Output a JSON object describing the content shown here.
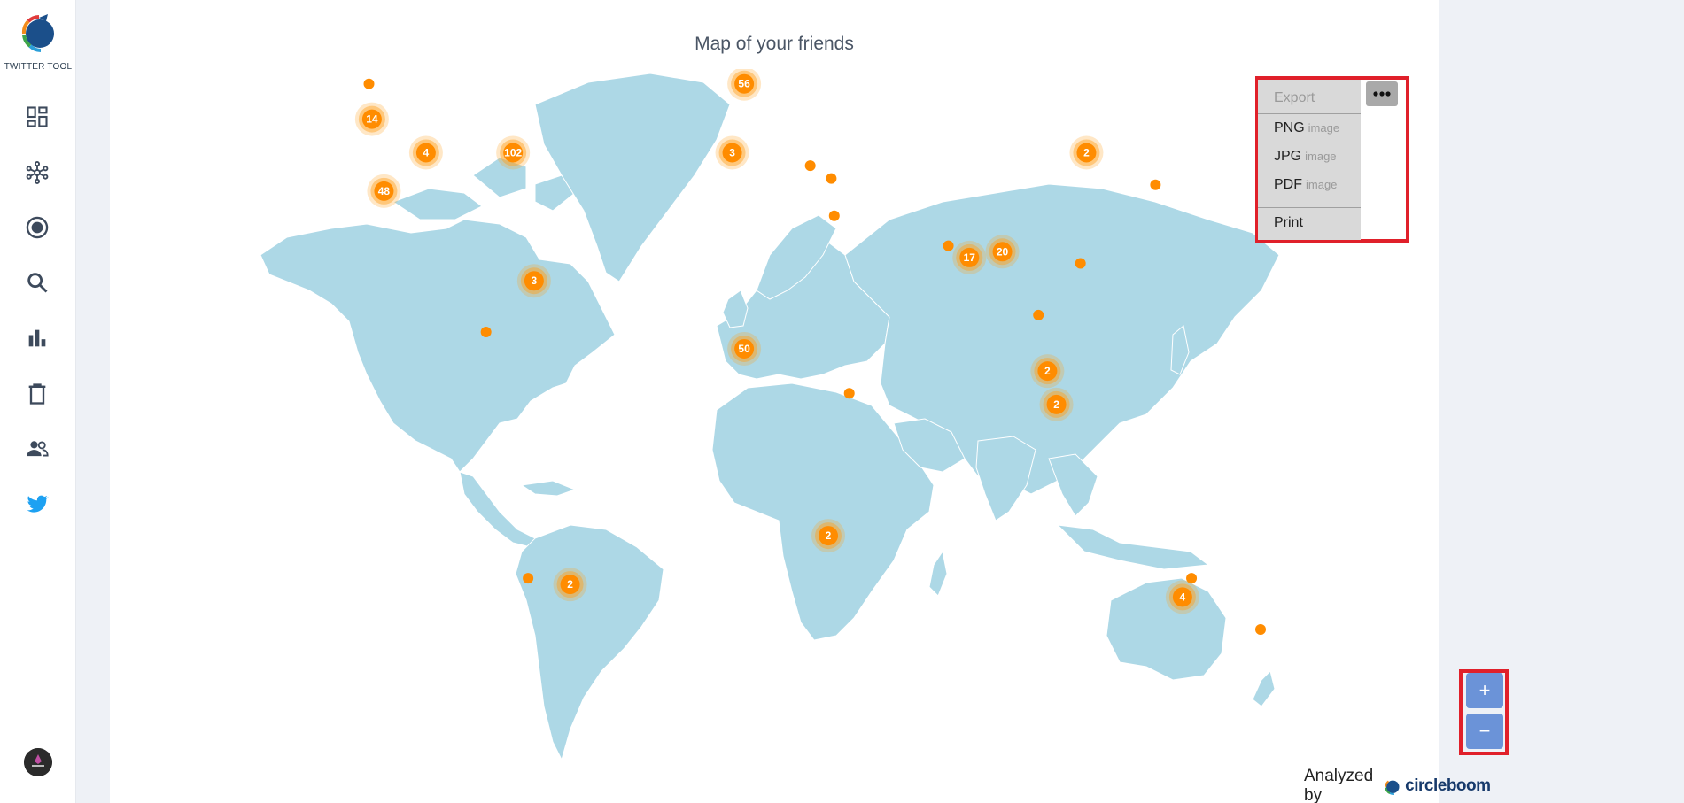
{
  "sidebar": {
    "logo_text": "TWITTER TOOL",
    "items": [
      {
        "icon": "dashboard-icon"
      },
      {
        "icon": "network-icon"
      },
      {
        "icon": "target-icon"
      },
      {
        "icon": "search-icon"
      },
      {
        "icon": "bar-chart-icon"
      },
      {
        "icon": "trash-icon"
      },
      {
        "icon": "users-icon"
      },
      {
        "icon": "twitter-bird-icon"
      }
    ]
  },
  "page": {
    "title": "Map of your friends"
  },
  "export_menu": {
    "header": "Export",
    "items": [
      {
        "label": "PNG",
        "sub": "image"
      },
      {
        "label": "JPG",
        "sub": "image"
      },
      {
        "label": "PDF",
        "sub": "image"
      }
    ],
    "print_label": "Print",
    "button_icon": "more-horizontal-icon"
  },
  "zoom": {
    "in_label": "+",
    "out_label": "−"
  },
  "footer": {
    "analyzed_by": "Analyzed by",
    "brand": "circleboom"
  },
  "map": {
    "clusters": [
      {
        "label": "14",
        "lon": -122,
        "lat": 45
      },
      {
        "label": "4",
        "lon": -104,
        "lat": 40
      },
      {
        "label": "48",
        "lon": -118,
        "lat": 34
      },
      {
        "label": "102",
        "lon": -75,
        "lat": 40
      },
      {
        "label": "3",
        "lon": -68,
        "lat": 19
      },
      {
        "label": "56",
        "lon": 2,
        "lat": 50
      },
      {
        "label": "3",
        "lon": -2,
        "lat": 40
      },
      {
        "label": "50",
        "lon": 2,
        "lat": 7
      },
      {
        "label": "2",
        "lon": 30,
        "lat": -26
      },
      {
        "label": "2",
        "lon": -56,
        "lat": -34
      },
      {
        "label": "17",
        "lon": 77,
        "lat": 23
      },
      {
        "label": "20",
        "lon": 88,
        "lat": 24
      },
      {
        "label": "2",
        "lon": 116,
        "lat": 40
      },
      {
        "label": "2",
        "lon": 103,
        "lat": 3
      },
      {
        "label": "2",
        "lon": 106,
        "lat": -3
      },
      {
        "label": "4",
        "lon": 148,
        "lat": -36
      }
    ],
    "points": [
      {
        "lon": -123,
        "lat": 50
      },
      {
        "lon": -84,
        "lat": 10
      },
      {
        "lon": -70,
        "lat": -33
      },
      {
        "lon": 11,
        "lat": 60
      },
      {
        "lon": 24,
        "lat": 38
      },
      {
        "lon": 31,
        "lat": 36
      },
      {
        "lon": 32,
        "lat": 30
      },
      {
        "lon": 37,
        "lat": -1
      },
      {
        "lon": 70,
        "lat": 25
      },
      {
        "lon": 114,
        "lat": 22
      },
      {
        "lon": 100,
        "lat": 13
      },
      {
        "lon": 139,
        "lat": 35
      },
      {
        "lon": 151,
        "lat": -33
      },
      {
        "lon": 174,
        "lat": -41
      }
    ]
  }
}
